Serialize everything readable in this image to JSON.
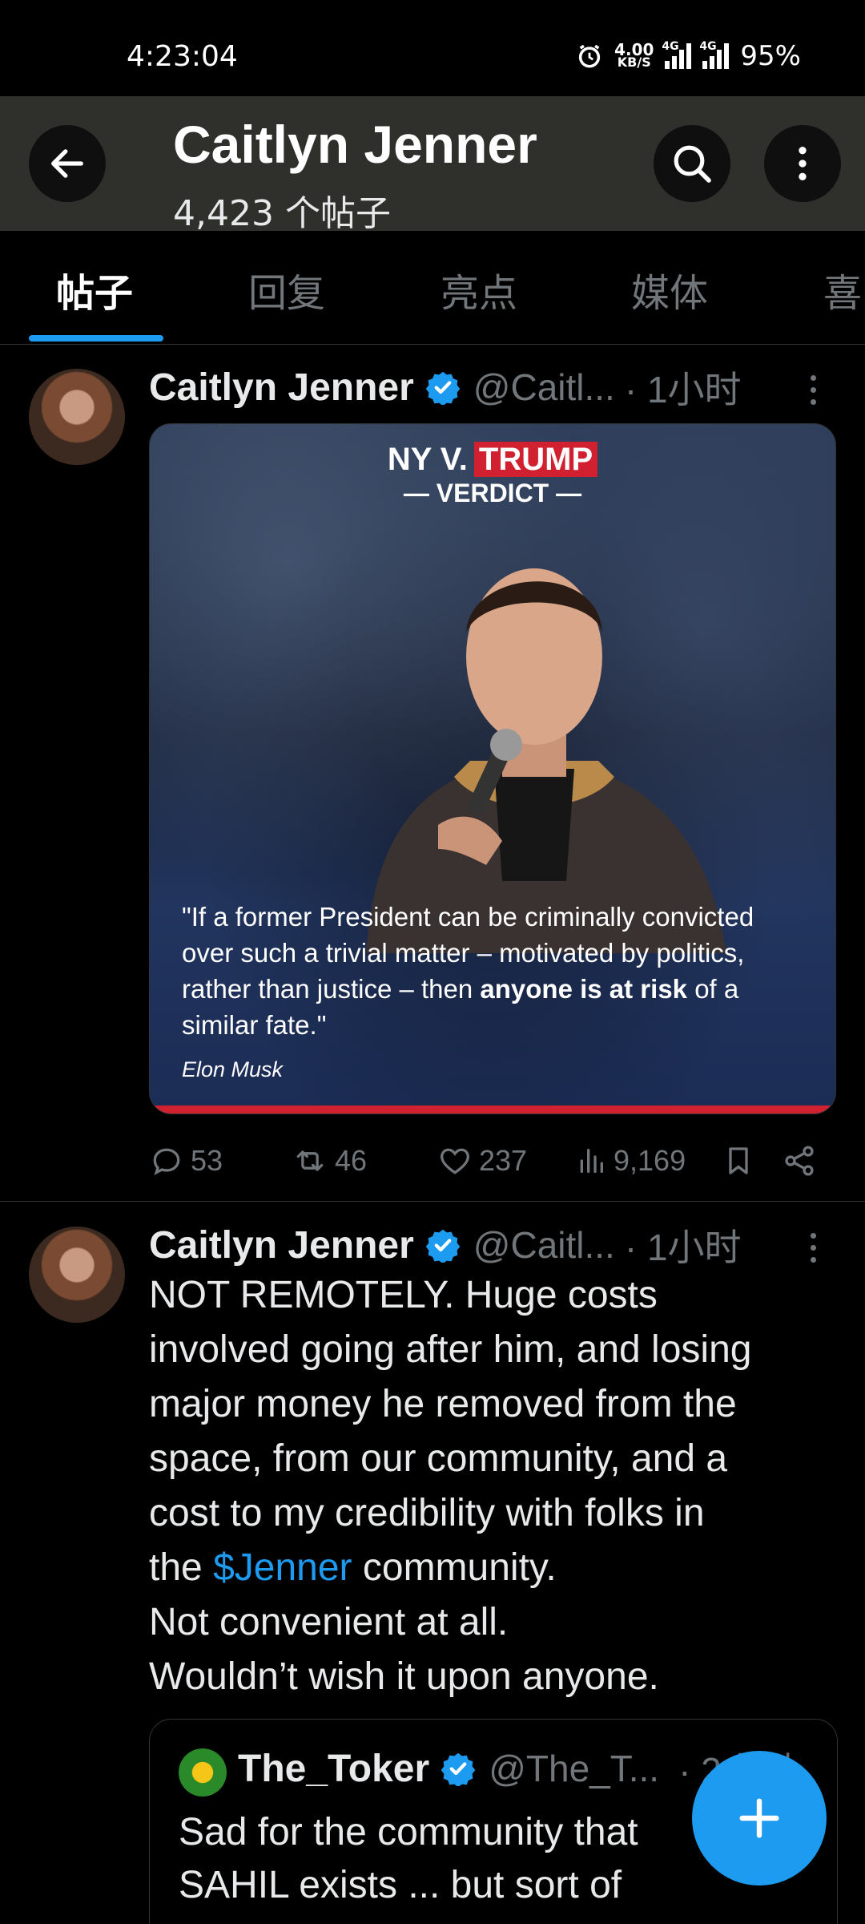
{
  "status_bar": {
    "time": "4:23:04",
    "speed_value": "4.00",
    "speed_unit": "KB/S",
    "battery": "95%"
  },
  "header": {
    "title": "Caitlyn Jenner",
    "post_count": "4,423 个帖子"
  },
  "tabs": [
    "帖子",
    "回复",
    "亮点",
    "媒体",
    "喜"
  ],
  "posts": [
    {
      "name": "Caitlyn Jenner",
      "handle": "@Caitl...",
      "time": "· 1小时",
      "media": {
        "banner_left": "NY V.",
        "banner_right": "TRUMP",
        "banner_sub": "— VERDICT —",
        "quote_1": "\"If a former President can be criminally convicted",
        "quote_2": "over such a trivial matter – motivated by politics,",
        "quote_3a": "rather than justice – then ",
        "quote_3b": "anyone is at risk",
        "quote_3c": " of a",
        "quote_4": "similar fate.\"",
        "author": "Elon Musk"
      },
      "stats": {
        "replies": "53",
        "reposts": "46",
        "likes": "237",
        "views": "9,169"
      }
    },
    {
      "name": "Caitlyn Jenner",
      "handle": "@Caitl...",
      "time": "· 1小时",
      "text": {
        "l1": "NOT REMOTELY. Huge costs",
        "l2": "involved going after him, and losing",
        "l3": "major money he removed from the",
        "l4": "space, from our community, and a",
        "l5": "cost to my credibility with folks in",
        "l6a": "the ",
        "l6_link": "$Jenner",
        "l6b": " community.",
        "l7": "Not convenient at all.",
        "l8": "Wouldn’t wish it upon anyone."
      },
      "quoted": {
        "name": "The_Toker",
        "handle": "@The_T...",
        "time": "· 2小时",
        "l1": "Sad for the community that",
        "l2": "SAHIL exists ... but sort of"
      }
    }
  ],
  "colors": {
    "accent": "#1d9bf0",
    "background": "#000000",
    "muted": "#71767b"
  }
}
